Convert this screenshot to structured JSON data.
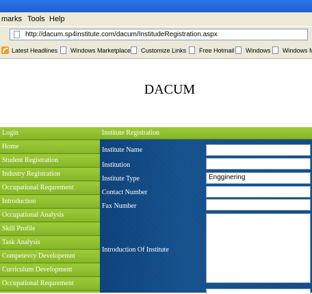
{
  "menu": {
    "items": [
      "marks",
      "Tools",
      "Help"
    ]
  },
  "address": {
    "url": "http://dacum.sp4institute.com/dacum/InstitudeRegistration.aspx"
  },
  "links": [
    "Latest Headlines",
    "Windows Marketplace",
    "Customize Links",
    "Free Hotmail",
    "Windows",
    "Windows Media"
  ],
  "site": {
    "title": "DACUM"
  },
  "nav": {
    "items": [
      "Login",
      "Home",
      "Student Registration",
      "Industry Registration",
      "Occupational Requrement",
      "Introduction",
      "Occupational Analysis",
      "Skill Profile",
      "Task Analysis",
      "Competevcy Developemnt",
      "Curriculum Development",
      "Occupational Requrement"
    ]
  },
  "form": {
    "heading": "Institute Registration",
    "labels": [
      "Institute Name",
      "Institution",
      "Institute Type",
      "Contact Number",
      "Fax Number",
      "Introduction Of Institute"
    ],
    "institute_type_value": "Engginering"
  },
  "colors": {
    "nav_green": "#8ebd2e",
    "form_blue": "#124f8c",
    "titlebar_blue": "#2f74e6"
  }
}
